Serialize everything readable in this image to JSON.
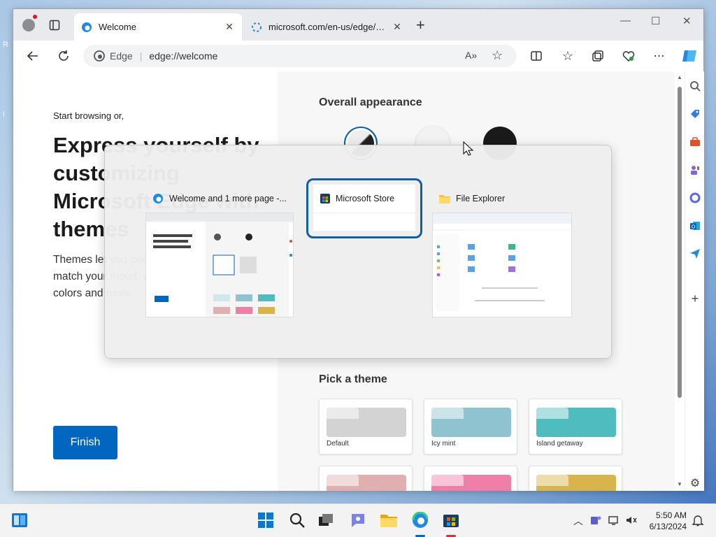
{
  "desktop": {
    "glyph1": "R",
    "glyph2": "I"
  },
  "tabs": [
    {
      "title": "Welcome",
      "close": "✕"
    },
    {
      "title": "microsoft.com/en-us/edge/welco",
      "close": "✕"
    }
  ],
  "newtab": "+",
  "window_controls": {
    "minimize": "—",
    "maximize": "☐",
    "close": "✕"
  },
  "address": {
    "site": "Edge",
    "url": "edge://welcome"
  },
  "page": {
    "start": "Start browsing or,",
    "headline": "Express yourself by customizing Microsoft Edge with themes",
    "para": "Themes let you personalize your browser to match your mood, with a large number of colors and more",
    "finish": "Finish",
    "appearance_title": "Overall appearance",
    "theme_title": "Pick a theme",
    "themes": [
      {
        "label": "Default",
        "color": "#d3d3d3"
      },
      {
        "label": "Icy mint",
        "color": "#8fc3cf"
      },
      {
        "label": "Island getaway",
        "color": "#4fbcc0"
      },
      {
        "label": "",
        "color": "#e0b0b0"
      },
      {
        "label": "",
        "color": "#f07fa8"
      },
      {
        "label": "",
        "color": "#d8b44a"
      }
    ]
  },
  "switcher": {
    "windows": [
      {
        "title": "Welcome and 1 more page -..."
      },
      {
        "title": "Microsoft Store"
      },
      {
        "title": "File Explorer"
      }
    ]
  },
  "tray": {
    "time": "5:50 AM",
    "date": "6/13/2024"
  },
  "colors": {
    "accent": "#0067c0",
    "focus": "#0f5ea8"
  }
}
